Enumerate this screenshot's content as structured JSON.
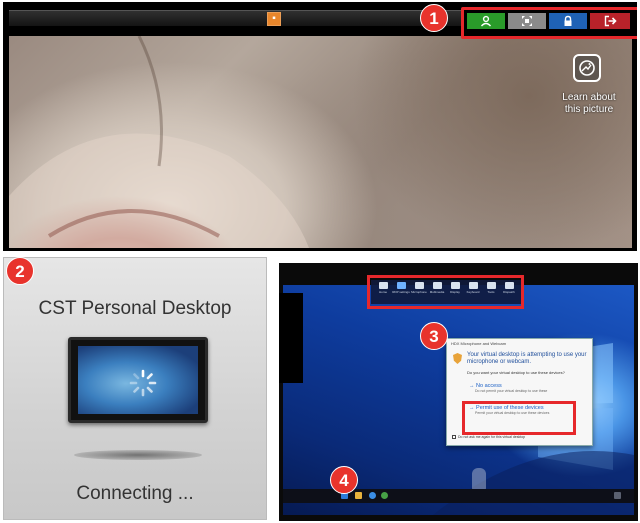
{
  "markers": [
    "1",
    "2",
    "3",
    "4"
  ],
  "panel1": {
    "learn_text_line1": "Learn about",
    "learn_text_line2": "this picture",
    "colors": {
      "user_button": "#2a9b2a",
      "move_button": "#8a8a8a",
      "lock_button": "#1f62b5",
      "exit_button": "#b8222a",
      "highlight": "#e6282b"
    },
    "icons": [
      "user-icon",
      "move-icon",
      "lock-icon",
      "exit-icon",
      "learn-picture-icon"
    ]
  },
  "panel2": {
    "title": "CST Personal Desktop",
    "status": "Connecting ..."
  },
  "panel3": {
    "toolbar_items": [
      "Home",
      "RDP settings",
      "Microphone",
      "Multimedia",
      "Display",
      "Keyboard",
      "Tools",
      "Dispatch"
    ],
    "dialog": {
      "title": "HDX Microphone and Webcam",
      "heading": "Your virtual desktop is attempting to use your microphone or webcam.",
      "question": "Do you want your virtual desktop to use these devices?",
      "option_no": "No access",
      "option_no_sub": "Do not permit your virtual desktop to use these",
      "option_yes": "Permit use of these devices",
      "option_yes_sub": "Permit your virtual desktop to use these devices",
      "dont_ask": "Do not ask me again for this virtual desktop"
    }
  }
}
